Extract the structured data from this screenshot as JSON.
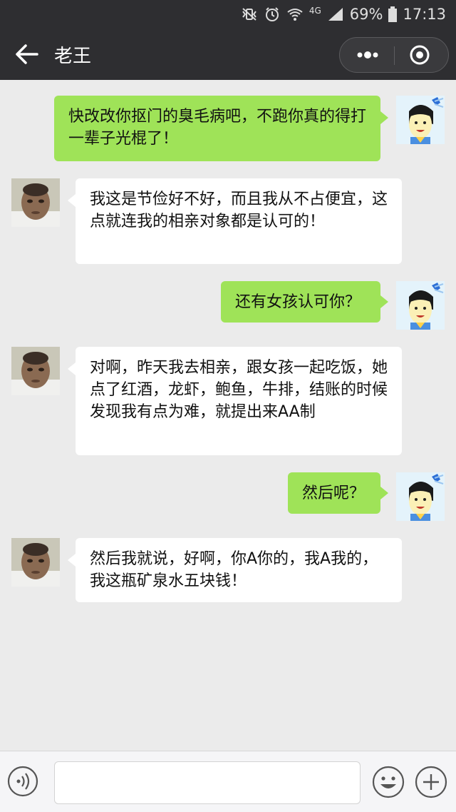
{
  "status_bar": {
    "battery": "69%",
    "time": "17:13",
    "network": "4G"
  },
  "header": {
    "title": "老王",
    "back_icon": "arrow-left-icon",
    "more_icon": "more-dots-icon",
    "close_icon": "circle-target-icon"
  },
  "messages": [
    {
      "sender": "me",
      "text": "快改改你抠门的臭毛病吧，不跑你真的得打一辈子光棍了！"
    },
    {
      "sender": "other",
      "text": "我这是节俭好不好，而且我从不占便宜，这点就连我的相亲对象都是认可的！"
    },
    {
      "sender": "me",
      "text": "还有女孩认可你？"
    },
    {
      "sender": "other",
      "text": "对啊，昨天我去相亲，跟女孩一起吃饭，她点了红酒，龙虾，鲍鱼，牛排，结账的时候发现我有点为难，就提出来AA制"
    },
    {
      "sender": "me",
      "text": "然后呢？"
    },
    {
      "sender": "other",
      "text": "然后我就说，好啊，你A你的，我A我的，我这瓶矿泉水五块钱！"
    }
  ],
  "input_bar": {
    "value": "",
    "voice_icon": "voice-icon",
    "emoji_icon": "emoji-icon",
    "plus_icon": "plus-icon"
  },
  "colors": {
    "header_bg": "#2e2e31",
    "chat_bg": "#ebebeb",
    "my_bubble": "#9fe358",
    "other_bubble": "#ffffff"
  }
}
